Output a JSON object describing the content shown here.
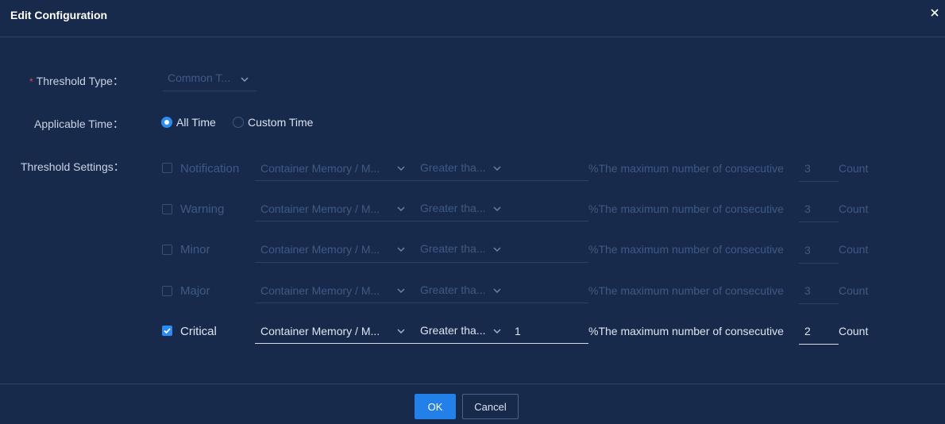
{
  "dialog": {
    "title": "Edit Configuration",
    "close_icon": "close-icon"
  },
  "form": {
    "required_mark": "*",
    "threshold_type": {
      "label": "Threshold Type：",
      "value": "Common T...",
      "disabled": true
    },
    "applicable_time": {
      "label": "Applicable Time：",
      "options": [
        {
          "label": "All Time",
          "selected": true
        },
        {
          "label": "Custom Time",
          "selected": false
        }
      ]
    },
    "threshold_settings": {
      "label": "Threshold Settings：",
      "rows": [
        {
          "level": "Notification",
          "checked": false,
          "metric": "Container Memory / M...",
          "operator": "Greater tha...",
          "value": "",
          "desc": "%The maximum number of consecutive",
          "count": "3",
          "unit": "Count"
        },
        {
          "level": "Warning",
          "checked": false,
          "metric": "Container Memory / M...",
          "operator": "Greater tha...",
          "value": "",
          "desc": "%The maximum number of consecutive",
          "count": "3",
          "unit": "Count"
        },
        {
          "level": "Minor",
          "checked": false,
          "metric": "Container Memory / M...",
          "operator": "Greater tha...",
          "value": "",
          "desc": "%The maximum number of consecutive",
          "count": "3",
          "unit": "Count"
        },
        {
          "level": "Major",
          "checked": false,
          "metric": "Container Memory / M...",
          "operator": "Greater tha...",
          "value": "",
          "desc": "%The maximum number of consecutive",
          "count": "3",
          "unit": "Count"
        },
        {
          "level": "Critical",
          "checked": true,
          "metric": "Container Memory / M...",
          "operator": "Greater tha...",
          "value": "1",
          "desc": "%The maximum number of consecutive",
          "count": "2",
          "unit": "Count"
        }
      ]
    }
  },
  "buttons": {
    "ok": "OK",
    "cancel": "Cancel"
  },
  "colors": {
    "background": "#172a4b",
    "accent": "#2b8cf4",
    "required": "#e8455a"
  }
}
